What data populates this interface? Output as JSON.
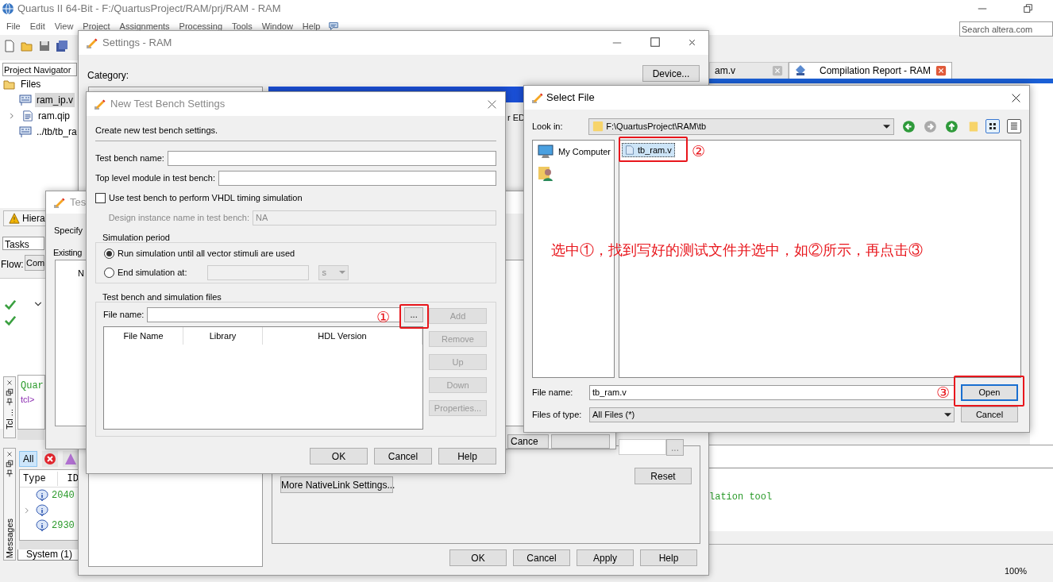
{
  "main_window": {
    "title": "Quartus II 64-Bit - F:/QuartusProject/RAM/prj/RAM - RAM",
    "menu": [
      "File",
      "Edit",
      "View",
      "Project",
      "Assignments",
      "Processing",
      "Tools",
      "Window",
      "Help"
    ],
    "search": {
      "placeholder": "Search altera.com"
    },
    "navigator": {
      "title": "Project Navigator",
      "tree": [
        {
          "label": "Files",
          "kind": "folder",
          "selected": false,
          "children": [
            {
              "label": "ram_ip.v",
              "kind": "verilog",
              "selected": true
            },
            {
              "label": "ram.qip",
              "kind": "qip",
              "selected": false,
              "expanded": false
            },
            {
              "label": "../tb/tb_ra",
              "kind": "verilog",
              "selected": false
            }
          ]
        }
      ]
    },
    "tabs": [
      {
        "label": "am.v",
        "selected": false
      },
      {
        "label": "Compilation Report - RAM",
        "selected": true
      }
    ],
    "hierarchy_tab": "Hiera",
    "tasks_dropdown": "Tasks",
    "flow_label": "Flow:",
    "flow_value": "Com",
    "tcl_console": {
      "tab": "Tcl ...",
      "lines": [
        {
          "text": "Quar",
          "kind": "output"
        },
        {
          "text": "tcl>",
          "kind": "prompt"
        }
      ]
    },
    "messages": {
      "tab": "Messages",
      "filters": [
        {
          "label": "All",
          "selected": true
        }
      ],
      "columns": [
        "Type",
        "ID"
      ],
      "rows": [
        {
          "id": "2040",
          "expandable": false
        },
        {
          "expandable": true
        },
        {
          "id": "2930",
          "expandable": false
        }
      ],
      "tabs": [
        "System (1)"
      ]
    },
    "output_text": "lation tool",
    "zoom_status": "100%"
  },
  "settings_dialog": {
    "title": "Settings - RAM",
    "category_label": "Category:",
    "device_button": "Device...",
    "fragment": "r ED",
    "nativelink_button": "More NativeLink Settings...",
    "reset_button": "Reset",
    "browse": "...",
    "buttons": [
      "OK",
      "Cancel",
      "Apply",
      "Help"
    ]
  },
  "test_benches_dialog": {
    "title": "Tes",
    "specify_text": "Specify",
    "existing_label": "Existing",
    "column_fragment": "N",
    "cancel_fragment": "Cance"
  },
  "new_test_bench_dialog": {
    "title": "New Test Bench Settings",
    "intro": "Create new test bench settings.",
    "fields": [
      {
        "label": "Test bench name:"
      },
      {
        "label": "Top level module in test bench:"
      }
    ],
    "vhdl_checkbox": {
      "label": "Use test bench to perform VHDL timing simulation",
      "checked": false
    },
    "instance_field": {
      "label": "Design instance name in test bench:",
      "value": "NA",
      "disabled": true
    },
    "period_group": {
      "title": "Simulation period",
      "options": [
        {
          "label": "Run simulation until all vector stimuli are used",
          "selected": true,
          "kind": "plain"
        },
        {
          "label": "End simulation at:",
          "selected": false,
          "kind": "time",
          "unit": "s"
        }
      ]
    },
    "files_group": {
      "title": "Test bench and simulation files",
      "file_name_label": "File name:",
      "browse": "...",
      "columns": [
        "File Name",
        "Library",
        "HDL Version"
      ],
      "side_buttons": [
        {
          "label": "Add",
          "disabled": true
        },
        {
          "label": "Remove",
          "disabled": true
        },
        {
          "label": "Up",
          "disabled": true
        },
        {
          "label": "Down",
          "disabled": true
        },
        {
          "label": "Properties...",
          "disabled": true
        }
      ]
    },
    "buttons": [
      "OK",
      "Cancel",
      "Help"
    ]
  },
  "select_file_dialog": {
    "title": "Select File",
    "look_in_label": "Look in:",
    "look_in": "F:\\QuartusProject\\RAM\\tb",
    "views": [
      {
        "kind": "icons",
        "selected": true
      },
      {
        "kind": "details",
        "selected": false
      }
    ],
    "places": [
      {
        "label": "My Computer"
      }
    ],
    "files": [
      {
        "label": "tb_ram.v",
        "selected": true
      }
    ],
    "file_name_label": "File name:",
    "file_name": "tb_ram.v",
    "type_label": "Files of type:",
    "type": "All Files (*)",
    "buttons": [
      "Open",
      "Cancel"
    ]
  },
  "annotations": {
    "instruction": "选中①，找到写好的测试文件并选中，如②所示，再点击③",
    "markers": [
      "①",
      "②",
      "③"
    ]
  }
}
